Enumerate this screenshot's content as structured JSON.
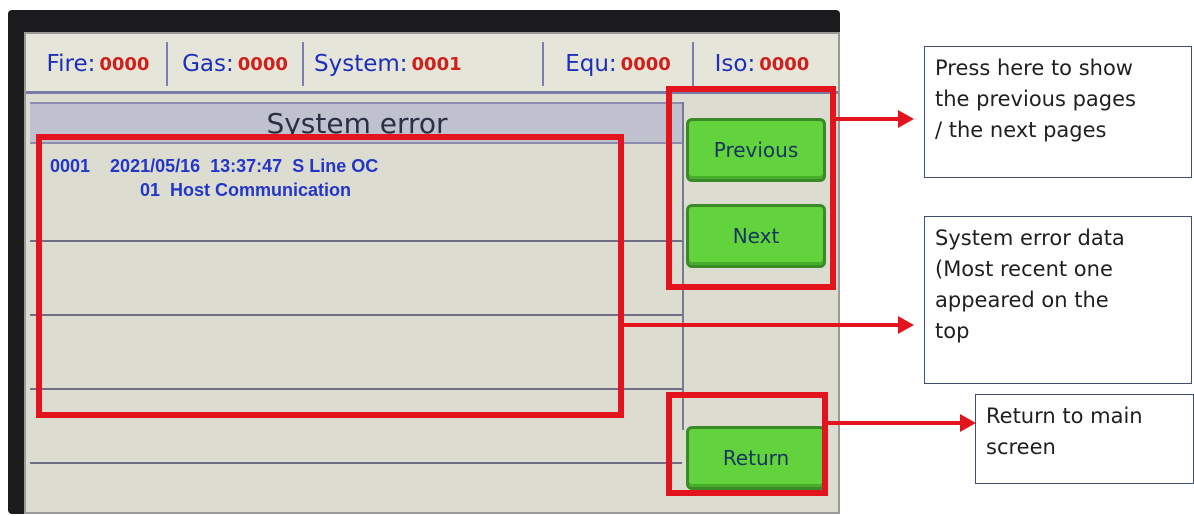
{
  "status_bar": {
    "items": [
      {
        "label": "Fire:",
        "value": "0000"
      },
      {
        "label": "Gas:",
        "value": "0000"
      },
      {
        "label": "System:",
        "value": "0001"
      },
      {
        "label": "Equ:",
        "value": "0000"
      },
      {
        "label": "Iso:",
        "value": "0000"
      }
    ]
  },
  "panel": {
    "title": "System error",
    "rows": [
      {
        "line1": "0001    2021/05/16  13:37:47  S Line OC",
        "line2": "01  Host Communication"
      },
      {
        "line1": "",
        "line2": ""
      },
      {
        "line1": "",
        "line2": ""
      },
      {
        "line1": "",
        "line2": ""
      }
    ]
  },
  "buttons": {
    "previous": "Previous",
    "next": "Next",
    "return": "Return"
  },
  "callouts": {
    "nav": [
      "Press here to show",
      "the previous pages",
      "/ the next pages"
    ],
    "data": [
      "System error data",
      "(Most recent one",
      "appeared on the",
      "top"
    ],
    "return": [
      "Return to main",
      "screen"
    ]
  },
  "colors": {
    "label_blue": "#1d2fb8",
    "value_red": "#d0201b",
    "button_green": "#62d33c",
    "highlight_red": "#e3141e"
  }
}
